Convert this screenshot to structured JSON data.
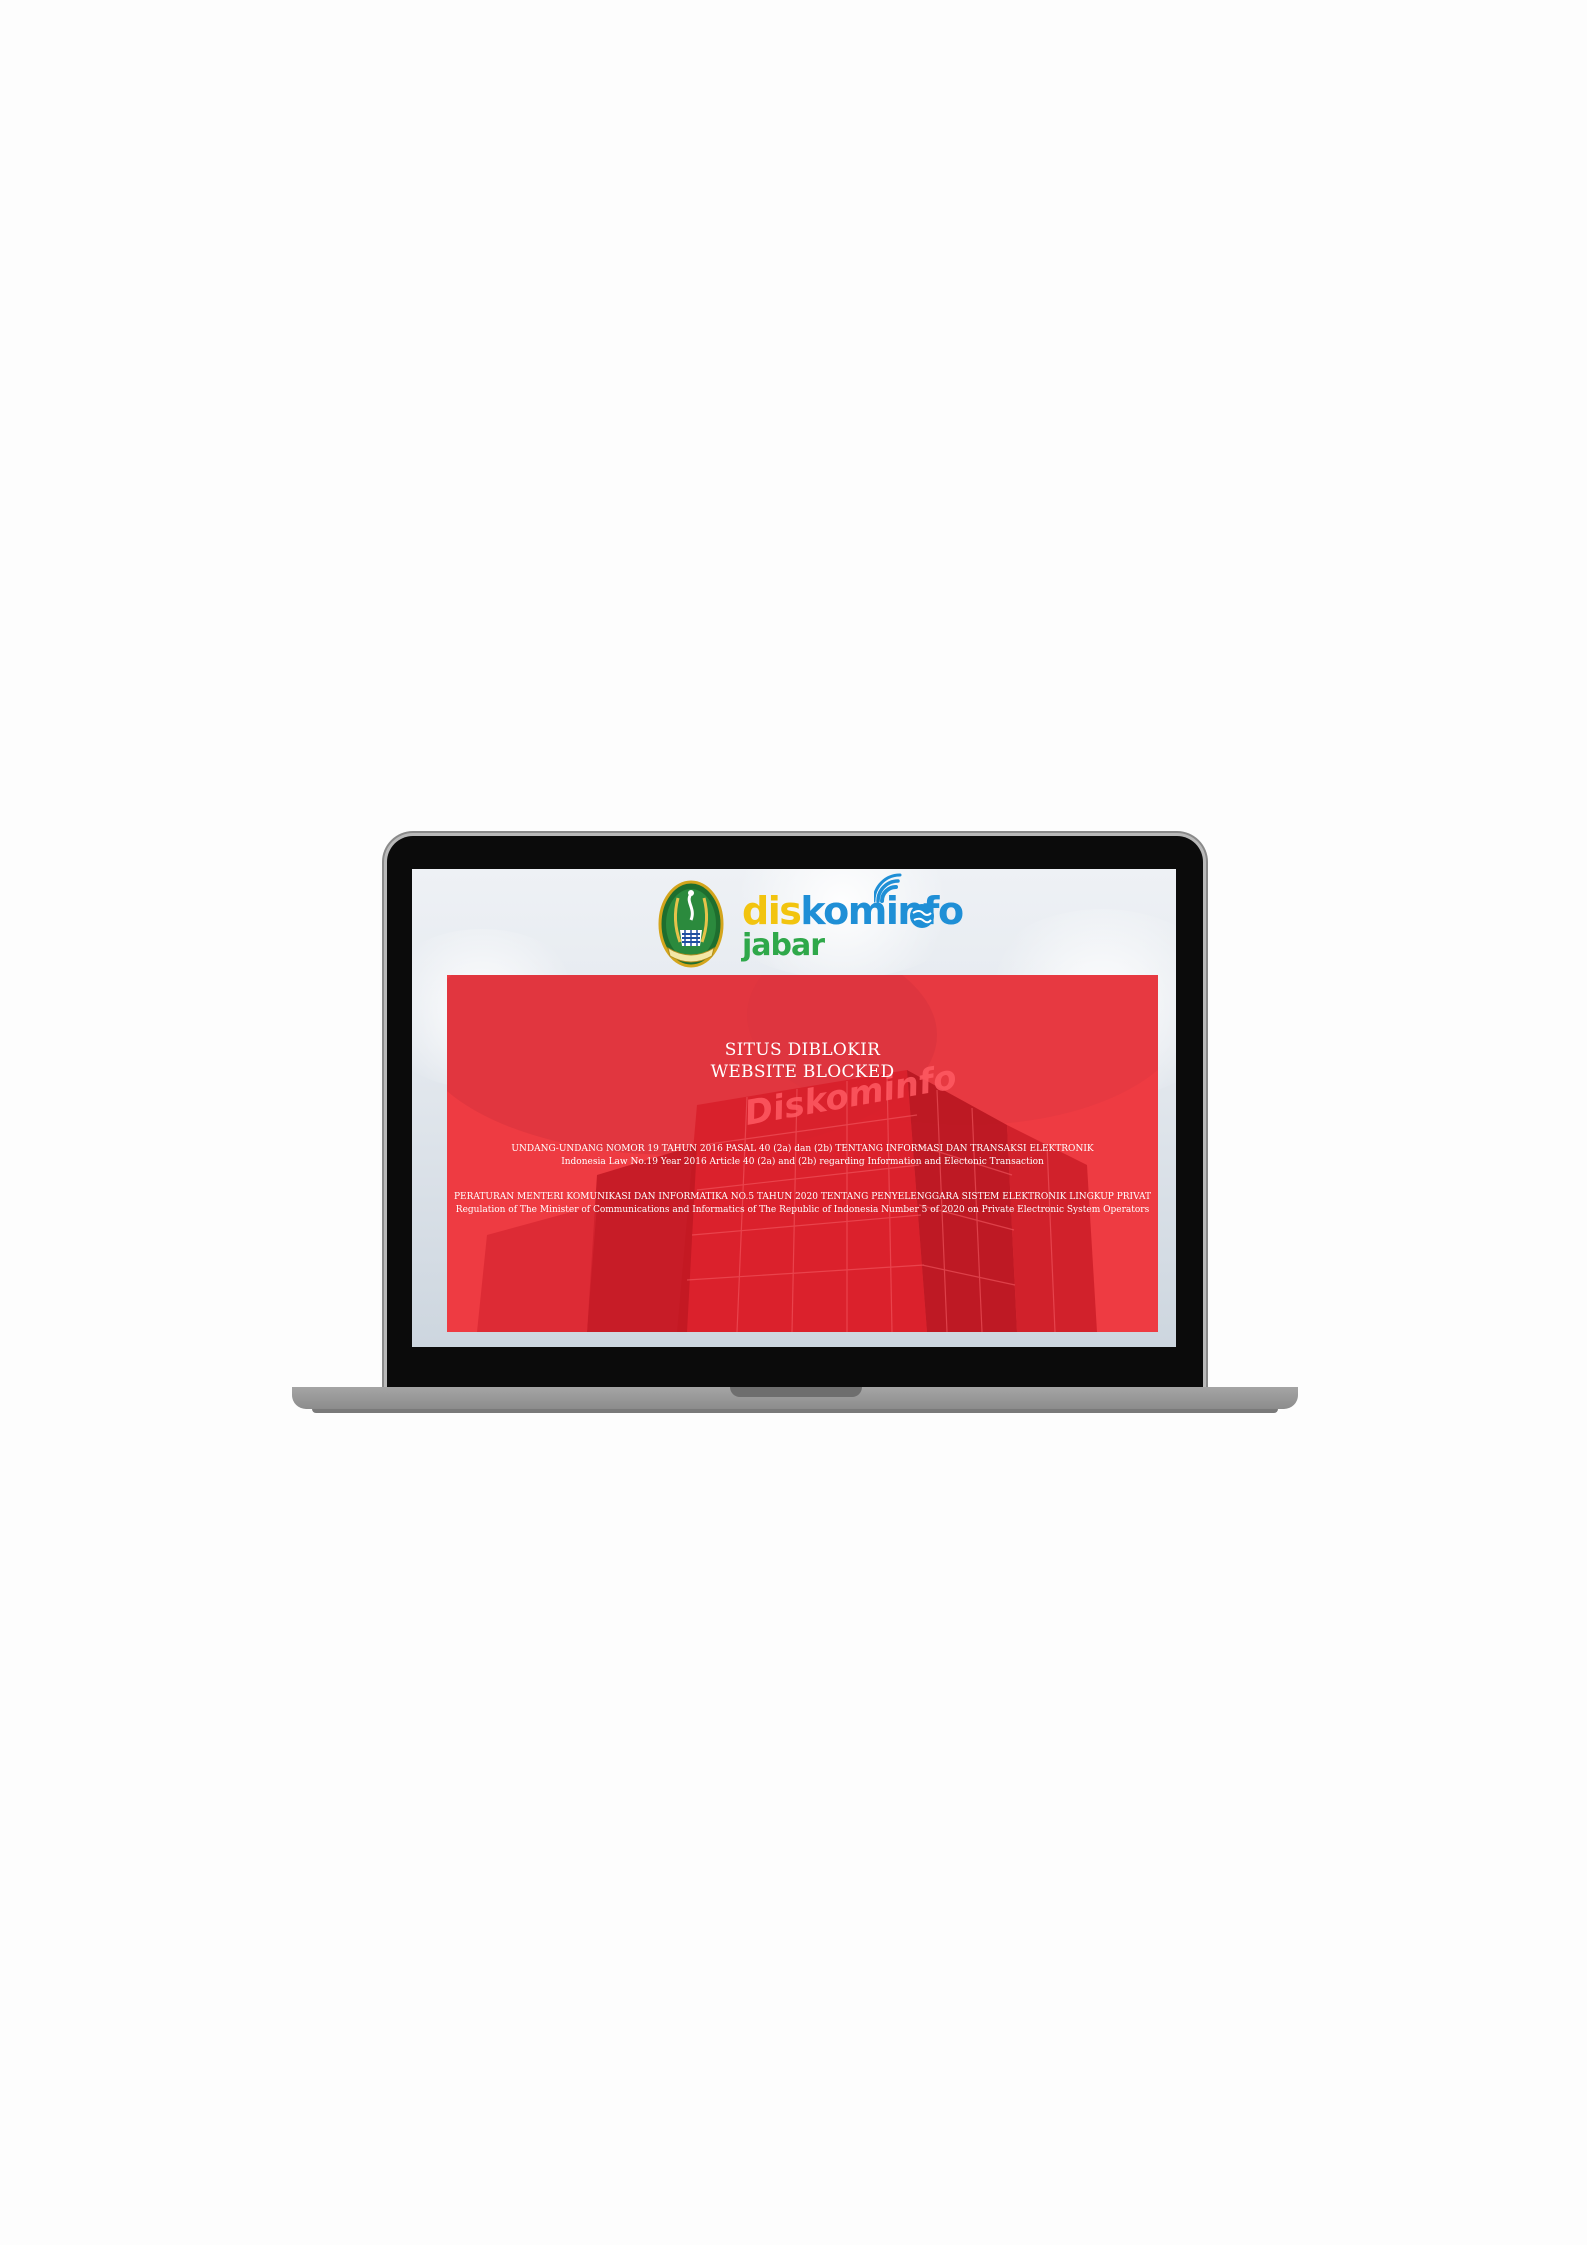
{
  "header": {
    "seal_icon": "west-java-seal-icon",
    "brand": {
      "part1": "dis",
      "part2": "kominf",
      "part3": "o",
      "line2": "jabar",
      "wifi_icon": "wifi-signal-icon",
      "globe_icon": "globe-icon"
    }
  },
  "notice": {
    "title_id": "SITUS DIBLOKIR",
    "title_en": "WEBSITE BLOCKED",
    "law1_id": "UNDANG-UNDANG NOMOR 19 TAHUN 2016 PASAL 40 (2a) dan (2b) TENTANG INFORMASI DAN TRANSAKSI ELEKTRONIK",
    "law1_en": "Indonesia Law No.19 Year 2016 Article 40 (2a) and (2b) regarding Information and Electonic Transaction",
    "law2_id": "PERATURAN MENTERI KOMUNIKASI DAN INFORMATIKA NO.5 TAHUN 2020 TENTANG PENYELENGGARA SISTEM ELEKTRONIK LINGKUP PRIVAT",
    "law2_en": "Regulation of The Minister of Communications and Informatics of The Republic of Indonesia Number 5 of 2020 on Private Electronic System Operators",
    "building_sign": "Diskominfo"
  },
  "colors": {
    "panel_red": "#ee3b42",
    "brand_yellow": "#f2c40f",
    "brand_blue": "#1f8fd6",
    "brand_green": "#2fa84a",
    "laptop_bezel": "#0b0b0b",
    "laptop_base": "#9a9a9a"
  }
}
